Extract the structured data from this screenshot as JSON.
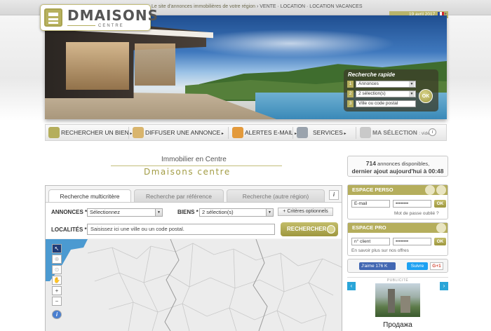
{
  "header": {
    "logo_text": "DMAISONS",
    "logo_sub": "CENTRE",
    "tagline": "Le site d'annonces immobilières de votre région",
    "tagline_sub": " › VENTE · LOCATION · LOCATION VACANCES",
    "date": "19 avril 2017"
  },
  "quick_search": {
    "title": "Recherche rapide",
    "rows": [
      {
        "num": "1",
        "value": "Annonces"
      },
      {
        "num": "2",
        "value": "2 sélection(s)"
      },
      {
        "num": "3",
        "value": "Ville ou code postal"
      }
    ],
    "ok_label": "OK"
  },
  "nav": {
    "items": [
      {
        "label": "RECHERCHER UN BIEN",
        "icon": "suitcase-icon"
      },
      {
        "label": "DIFFUSER UNE ANNONCE",
        "icon": "megaphone-icon"
      },
      {
        "label": "ALERTES E-MAIL",
        "icon": "email-alert-icon"
      },
      {
        "label": "SERVICES",
        "icon": "services-icon"
      }
    ],
    "selection_label": "MA SÉLECTION",
    "selection_state": ": vide"
  },
  "main": {
    "title_top": "Immobilier en Centre",
    "title_bottom": "Dmaisons centre"
  },
  "search": {
    "tabs": [
      {
        "label": "Recherche multicritère",
        "active": true
      },
      {
        "label": "Recherche par référence",
        "active": false
      },
      {
        "label": "Recherche (autre région)",
        "active": false
      }
    ],
    "annonces_label": "ANNONCES *",
    "annonces_value": "Sélectionnez",
    "biens_label": "BIENS *",
    "biens_value": "2 sélection(s)",
    "criteria_label": "+ Critères optionnels",
    "localites_label": "LOCALITÉS *",
    "localites_placeholder": "Saisissez ici une ville ou un code postal.",
    "search_label": "RECHERCHER"
  },
  "stats": {
    "count": "714",
    "line1": " annonces disponibles,",
    "line2": "dernier ajout aujourd'hui à 00:48"
  },
  "espace_perso": {
    "title": "ESPACE PERSO",
    "email_value": "E-mail",
    "password_value": "••••••••",
    "ok": "OK",
    "forgot": "Mot de passe oublié ?"
  },
  "espace_pro": {
    "title": "ESPACE PRO",
    "client_value": "n° client",
    "password_value": "••••••••",
    "ok": "OK",
    "more": "En savoir plus sur nos offres"
  },
  "social": {
    "fb_label": "J'aime 176 K",
    "tw_label": "Suivre",
    "gp_label": "G+1"
  },
  "ad": {
    "label": "PUBLICITÉ",
    "text": "Продажа"
  },
  "colors": {
    "accent": "#b5ae5c",
    "accent_dark": "#9e973f",
    "facebook": "#4267b2",
    "twitter": "#1da1f2",
    "sea": "#4b9ad1"
  }
}
